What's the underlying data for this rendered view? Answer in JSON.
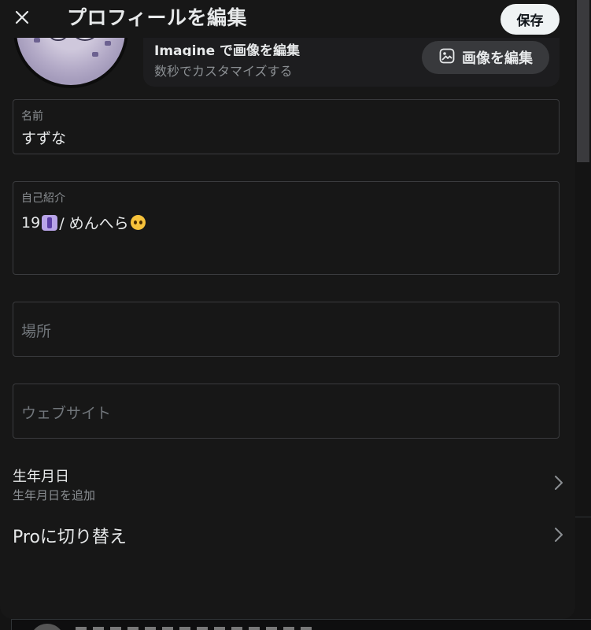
{
  "header": {
    "title": "プロフィールを編集",
    "save_label": "保存"
  },
  "imagine": {
    "title": "Imagine で画像を編集",
    "subtitle": "数秒でカスタマイズする",
    "edit_button_label": "画像を編集"
  },
  "fields": {
    "name": {
      "label": "名前",
      "value": "すずな"
    },
    "bio": {
      "label": "自己紹介",
      "value_start": "19",
      "value_end": "/ めんへら"
    },
    "location": {
      "placeholder": "場所"
    },
    "website": {
      "placeholder": "ウェブサイト"
    }
  },
  "rows": {
    "birthday": {
      "title": "生年月日",
      "subtitle": "生年月日を追加"
    },
    "pro": {
      "title": "Proに切り替え"
    }
  },
  "icons": {
    "close": "close-icon",
    "edit_image": "image-edit-icon",
    "chevron": "chevron-right-icon"
  },
  "colors": {
    "modal_bg": "#171717",
    "text_primary": "#e7e9ea",
    "text_secondary": "#8b8f93",
    "field_border": "#3a3b3e",
    "save_bg": "#eff3f4"
  }
}
